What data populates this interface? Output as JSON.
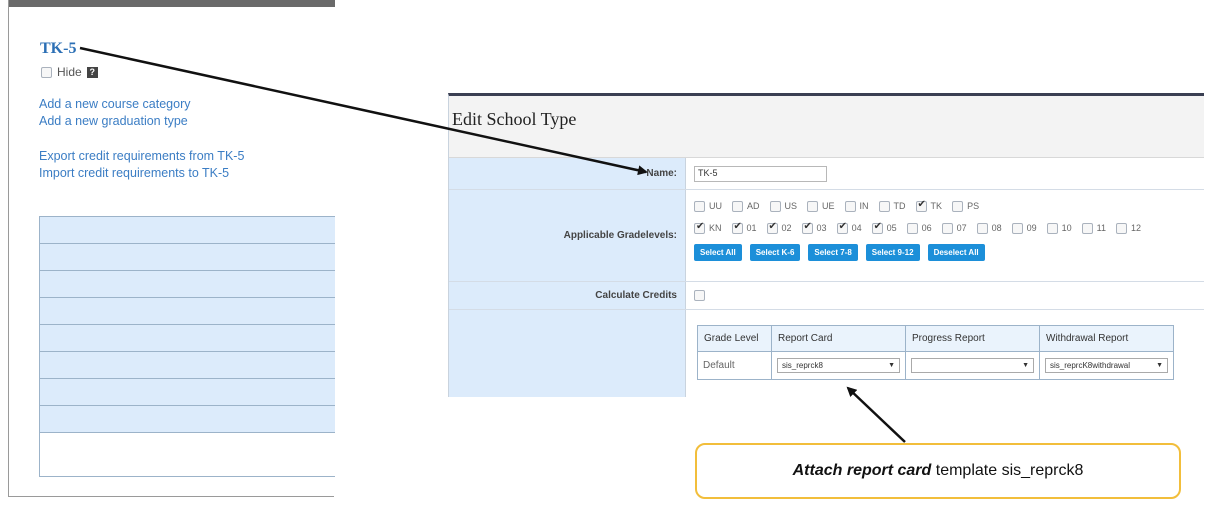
{
  "left": {
    "title": "TK-5",
    "hide_label": "Hide",
    "help_glyph": "?",
    "links": [
      "Add a new course category",
      "Add a new graduation type",
      "Export credit requirements from TK-5",
      "Import credit requirements to TK-5"
    ]
  },
  "form": {
    "title": "Edit School Type",
    "name_label": "Name:",
    "name_value": "TK-5",
    "grades_label": "Applicable Gradelevels:",
    "grades_row1": [
      {
        "label": "UU",
        "checked": false
      },
      {
        "label": "AD",
        "checked": false
      },
      {
        "label": "US",
        "checked": false
      },
      {
        "label": "UE",
        "checked": false
      },
      {
        "label": "IN",
        "checked": false
      },
      {
        "label": "TD",
        "checked": false
      },
      {
        "label": "TK",
        "checked": true
      },
      {
        "label": "PS",
        "checked": false
      }
    ],
    "grades_row2": [
      {
        "label": "KN",
        "checked": true
      },
      {
        "label": "01",
        "checked": true
      },
      {
        "label": "02",
        "checked": true
      },
      {
        "label": "03",
        "checked": true
      },
      {
        "label": "04",
        "checked": true
      },
      {
        "label": "05",
        "checked": true
      },
      {
        "label": "06",
        "checked": false
      },
      {
        "label": "07",
        "checked": false
      },
      {
        "label": "08",
        "checked": false
      },
      {
        "label": "09",
        "checked": false
      },
      {
        "label": "10",
        "checked": false
      },
      {
        "label": "11",
        "checked": false
      },
      {
        "label": "12",
        "checked": false
      }
    ],
    "buttons": [
      "Select All",
      "Select K-6",
      "Select 7-8",
      "Select 9-12",
      "Deselect All"
    ],
    "credits_label": "Calculate Credits",
    "table": {
      "headers": [
        "Grade Level",
        "Report Card",
        "Progress Report",
        "Withdrawal Report"
      ],
      "row": {
        "grade": "Default",
        "report_card": "sis_reprck8",
        "progress_report": "",
        "withdrawal_report": "sis_reprcK8withdrawal"
      }
    }
  },
  "callout": {
    "emphasis": "Attach report card",
    "rest": " template sis_reprck8"
  },
  "colors": {
    "link": "#3b7dc4",
    "label_bg": "#dcebfb",
    "button": "#1c8fd9",
    "callout_border": "#f2be3b"
  }
}
